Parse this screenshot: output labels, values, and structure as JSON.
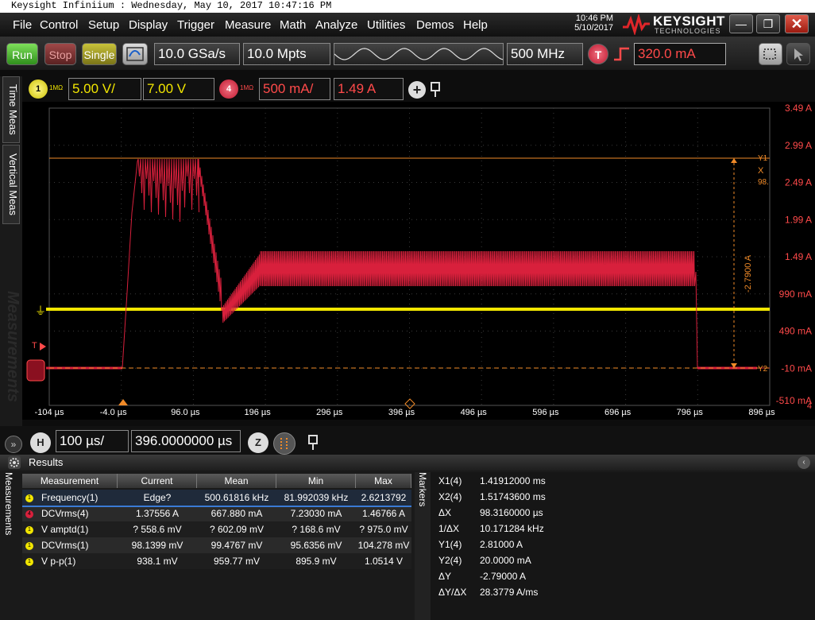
{
  "window_title": "Keysight Infiniium : Wednesday, May 10, 2017 10:47:16 PM",
  "menu": [
    "File",
    "Control",
    "Setup",
    "Display",
    "Trigger",
    "Measure",
    "Math",
    "Analyze",
    "Utilities",
    "Demos",
    "Help"
  ],
  "clock": {
    "time": "10:46 PM",
    "date": "5/10/2017"
  },
  "logo": {
    "brand": "KEYSIGHT",
    "sub": "TECHNOLOGIES"
  },
  "window_buttons": {
    "minimize": "—",
    "maximize": "❐",
    "close": "✕"
  },
  "run_controls": {
    "run": "Run",
    "stop": "Stop",
    "single": "Single"
  },
  "acquisition": {
    "sample_rate": "10.0 GSa/s",
    "memory_depth": "10.0 Mpts",
    "bandwidth": "500 MHz"
  },
  "trigger": {
    "badge": "T",
    "level": "320.0 mA"
  },
  "channels": {
    "ch1": {
      "number": "1",
      "impedance": "1MΩ",
      "scale": "5.00 V/",
      "offset": "7.00 V",
      "color": "#f2e600"
    },
    "ch4": {
      "number": "4",
      "impedance": "1MΩ",
      "scale": "500 mA/",
      "offset": "1.49 A",
      "color": "#d8203c"
    }
  },
  "side_tabs": [
    "Time Meas",
    "Vertical Meas"
  ],
  "side_watermark": "Measurements",
  "plot": {
    "y_labels": [
      "3.49 A",
      "2.99 A",
      "2.49 A",
      "1.99 A",
      "1.49 A",
      "990 mA",
      "490 mA",
      "-10 mA",
      "-510 mA"
    ],
    "x_labels": [
      "-104 µs",
      "-4.0 µs",
      "96.0 µs",
      "196 µs",
      "296 µs",
      "396 µs",
      "496 µs",
      "596 µs",
      "696 µs",
      "796 µs",
      "896 µs"
    ],
    "x_marker_label": "X",
    "x_marker_value": "98.",
    "y1_label": "Y1",
    "y2_label": "Y2",
    "delta_y_label": "-2.7900 A",
    "edge_digit": "4",
    "ground_marker": "⏚",
    "trigger_marker": "T"
  },
  "horizontal": {
    "badge": "H",
    "scale": "100 µs/",
    "position": "396.0000000 µs",
    "zoom": "Z"
  },
  "results": {
    "title": "Results",
    "side_label": "Measurements",
    "columns": [
      "Measurement",
      "Current",
      "Mean",
      "Min",
      "Max"
    ],
    "rows": [
      {
        "icon_color": "#f2e600",
        "icon": "1",
        "name": "Frequency(1)",
        "current": "Edge?",
        "mean": "500.61816 kHz",
        "min": "81.992039 kHz",
        "max": "2.6213792"
      },
      {
        "icon_color": "#d8203c",
        "icon": "4",
        "name": "DCVrms(4)",
        "current": "1.37556 A",
        "mean": "667.880 mA",
        "min": "7.23030 mA",
        "max": "1.46766 A"
      },
      {
        "icon_color": "#f2e600",
        "icon": "1",
        "name": "V amptd(1)",
        "current": "? 558.6 mV",
        "mean": "? 602.09 mV",
        "min": "? 168.6 mV",
        "max": "? 975.0 mV"
      },
      {
        "icon_color": "#f2e600",
        "icon": "1",
        "name": "DCVrms(1)",
        "current": "98.1399 mV",
        "mean": "99.4767 mV",
        "min": "95.6356 mV",
        "max": "104.278 mV"
      },
      {
        "icon_color": "#f2e600",
        "icon": "1",
        "name": "V p-p(1)",
        "current": "938.1 mV",
        "mean": "959.77 mV",
        "min": "895.9 mV",
        "max": "1.0514 V"
      }
    ]
  },
  "markers": {
    "side_label": "Markers",
    "rows": [
      {
        "label": "X1(4)",
        "value": "1.41912000 ms"
      },
      {
        "label": "X2(4)",
        "value": "1.51743600 ms"
      },
      {
        "label": "ΔX",
        "value": "98.3160000 µs"
      },
      {
        "label": "1/ΔX",
        "value": "10.171284 kHz"
      },
      {
        "label": "Y1(4)",
        "value": "2.81000 A"
      },
      {
        "label": "Y2(4)",
        "value": "20.0000 mA"
      },
      {
        "label": "ΔY",
        "value": "-2.79000 A"
      },
      {
        "label": "ΔY/ΔX",
        "value": "28.3779 A/ms"
      }
    ]
  }
}
